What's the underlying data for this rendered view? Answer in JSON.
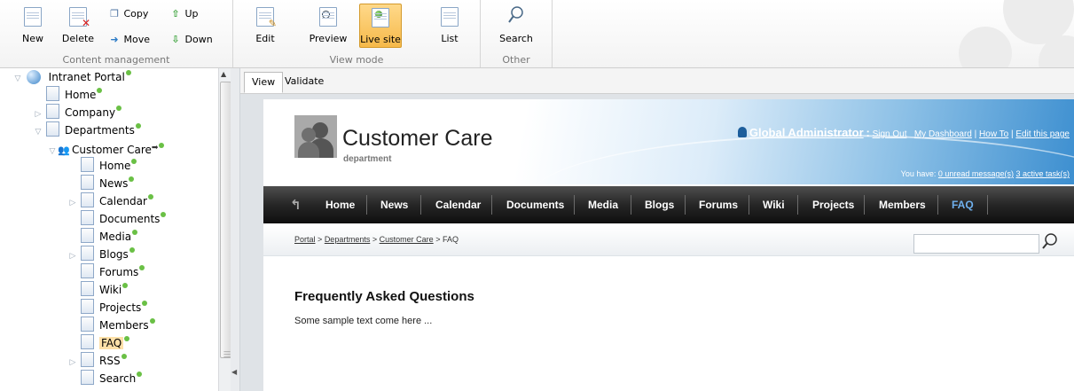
{
  "ribbon": {
    "content_management": {
      "label": "Content management",
      "new": "New",
      "delete": "Delete",
      "copy": "Copy",
      "move": "Move",
      "up": "Up",
      "down": "Down"
    },
    "view_mode": {
      "label": "View mode",
      "edit": "Edit",
      "preview": "Preview",
      "live_site": "Live site",
      "list": "List",
      "active": "Live site"
    },
    "other": {
      "label": "Other",
      "search": "Search"
    }
  },
  "tree": {
    "items": [
      {
        "label": "Intranet Portal"
      },
      {
        "label": "Home"
      },
      {
        "label": "Company"
      },
      {
        "label": "Departments"
      },
      {
        "label": "Customer Care"
      },
      {
        "label": "Home"
      },
      {
        "label": "News"
      },
      {
        "label": "Calendar"
      },
      {
        "label": "Documents"
      },
      {
        "label": "Media"
      },
      {
        "label": "Blogs"
      },
      {
        "label": "Forums"
      },
      {
        "label": "Wiki"
      },
      {
        "label": "Projects"
      },
      {
        "label": "Members"
      },
      {
        "label": "FAQ"
      },
      {
        "label": "RSS"
      },
      {
        "label": "Search"
      }
    ],
    "selected": "FAQ",
    "status_color": "#6ac045"
  },
  "tabs": {
    "view": "View",
    "validate": "Validate",
    "active": "View"
  },
  "site": {
    "title": "Customer Care",
    "subtitle": "department",
    "user": {
      "name": "Global Administrator",
      "separator": ":",
      "sign_out": "Sign Out",
      "dashboard": "My Dashboard",
      "how_to": "How To",
      "edit_page": "Edit this page",
      "pipe": "|"
    },
    "messages": {
      "prefix": "You have:",
      "unread": "0 unread message(s)",
      "tasks": "3 active task(s)"
    },
    "nav": [
      "Home",
      "News",
      "Calendar",
      "Documents",
      "Media",
      "Blogs",
      "Forums",
      "Wiki",
      "Projects",
      "Members",
      "FAQ"
    ],
    "nav_current": "FAQ",
    "breadcrumb": {
      "portal": "Portal",
      "departments": "Departments",
      "customer_care": "Customer Care",
      "current": "FAQ",
      "sep": ">"
    },
    "content": {
      "heading": "Frequently Asked Questions",
      "text": "Some sample text come here ..."
    },
    "colors": {
      "nav_current": "#6fb0ee",
      "header_blue": "#3d8fd0"
    }
  }
}
